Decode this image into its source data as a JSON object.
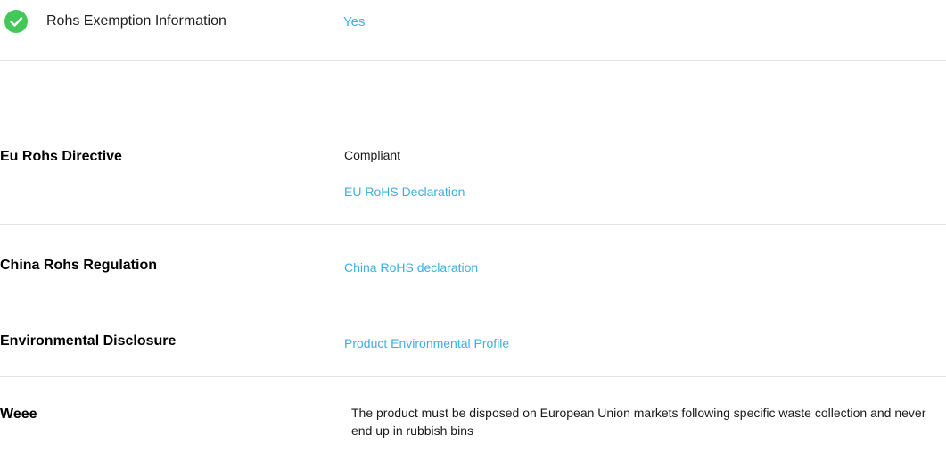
{
  "rohs_exemption": {
    "label": "Rohs Exemption Information",
    "value": "Yes",
    "icon": "check-circle-icon",
    "icon_color": "#43c759"
  },
  "rows": [
    {
      "label": "Eu Rohs Directive",
      "status": "Compliant",
      "link": "EU RoHS Declaration"
    },
    {
      "label": "China Rohs Regulation",
      "link": "China RoHS declaration"
    },
    {
      "label": "Environmental Disclosure",
      "link": "Product Environmental Profile"
    },
    {
      "label": "Weee",
      "text": "The product must be disposed on European Union markets following specific waste collection and never end up in rubbish bins"
    }
  ],
  "colors": {
    "link": "#3dafe0",
    "divider": "#e2e2e2"
  }
}
